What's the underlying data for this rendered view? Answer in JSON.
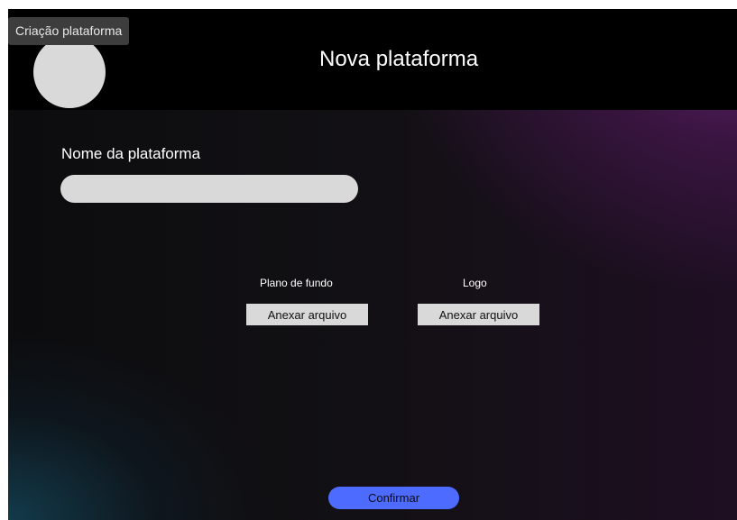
{
  "frame": {
    "tag_label": "Criação plataforma"
  },
  "header": {
    "title": "Nova plataforma"
  },
  "form": {
    "name_label": "Nome da plataforma",
    "name_value": "",
    "uploads": {
      "background_label": "Plano de fundo",
      "background_button": "Anexar arquivo",
      "logo_label": "Logo",
      "logo_button": "Anexar arquivo"
    },
    "confirm_label": "Confirmar"
  },
  "colors": {
    "accent": "#4d6cff",
    "input_bg": "#d9d9d9",
    "header_bg": "#000000"
  }
}
